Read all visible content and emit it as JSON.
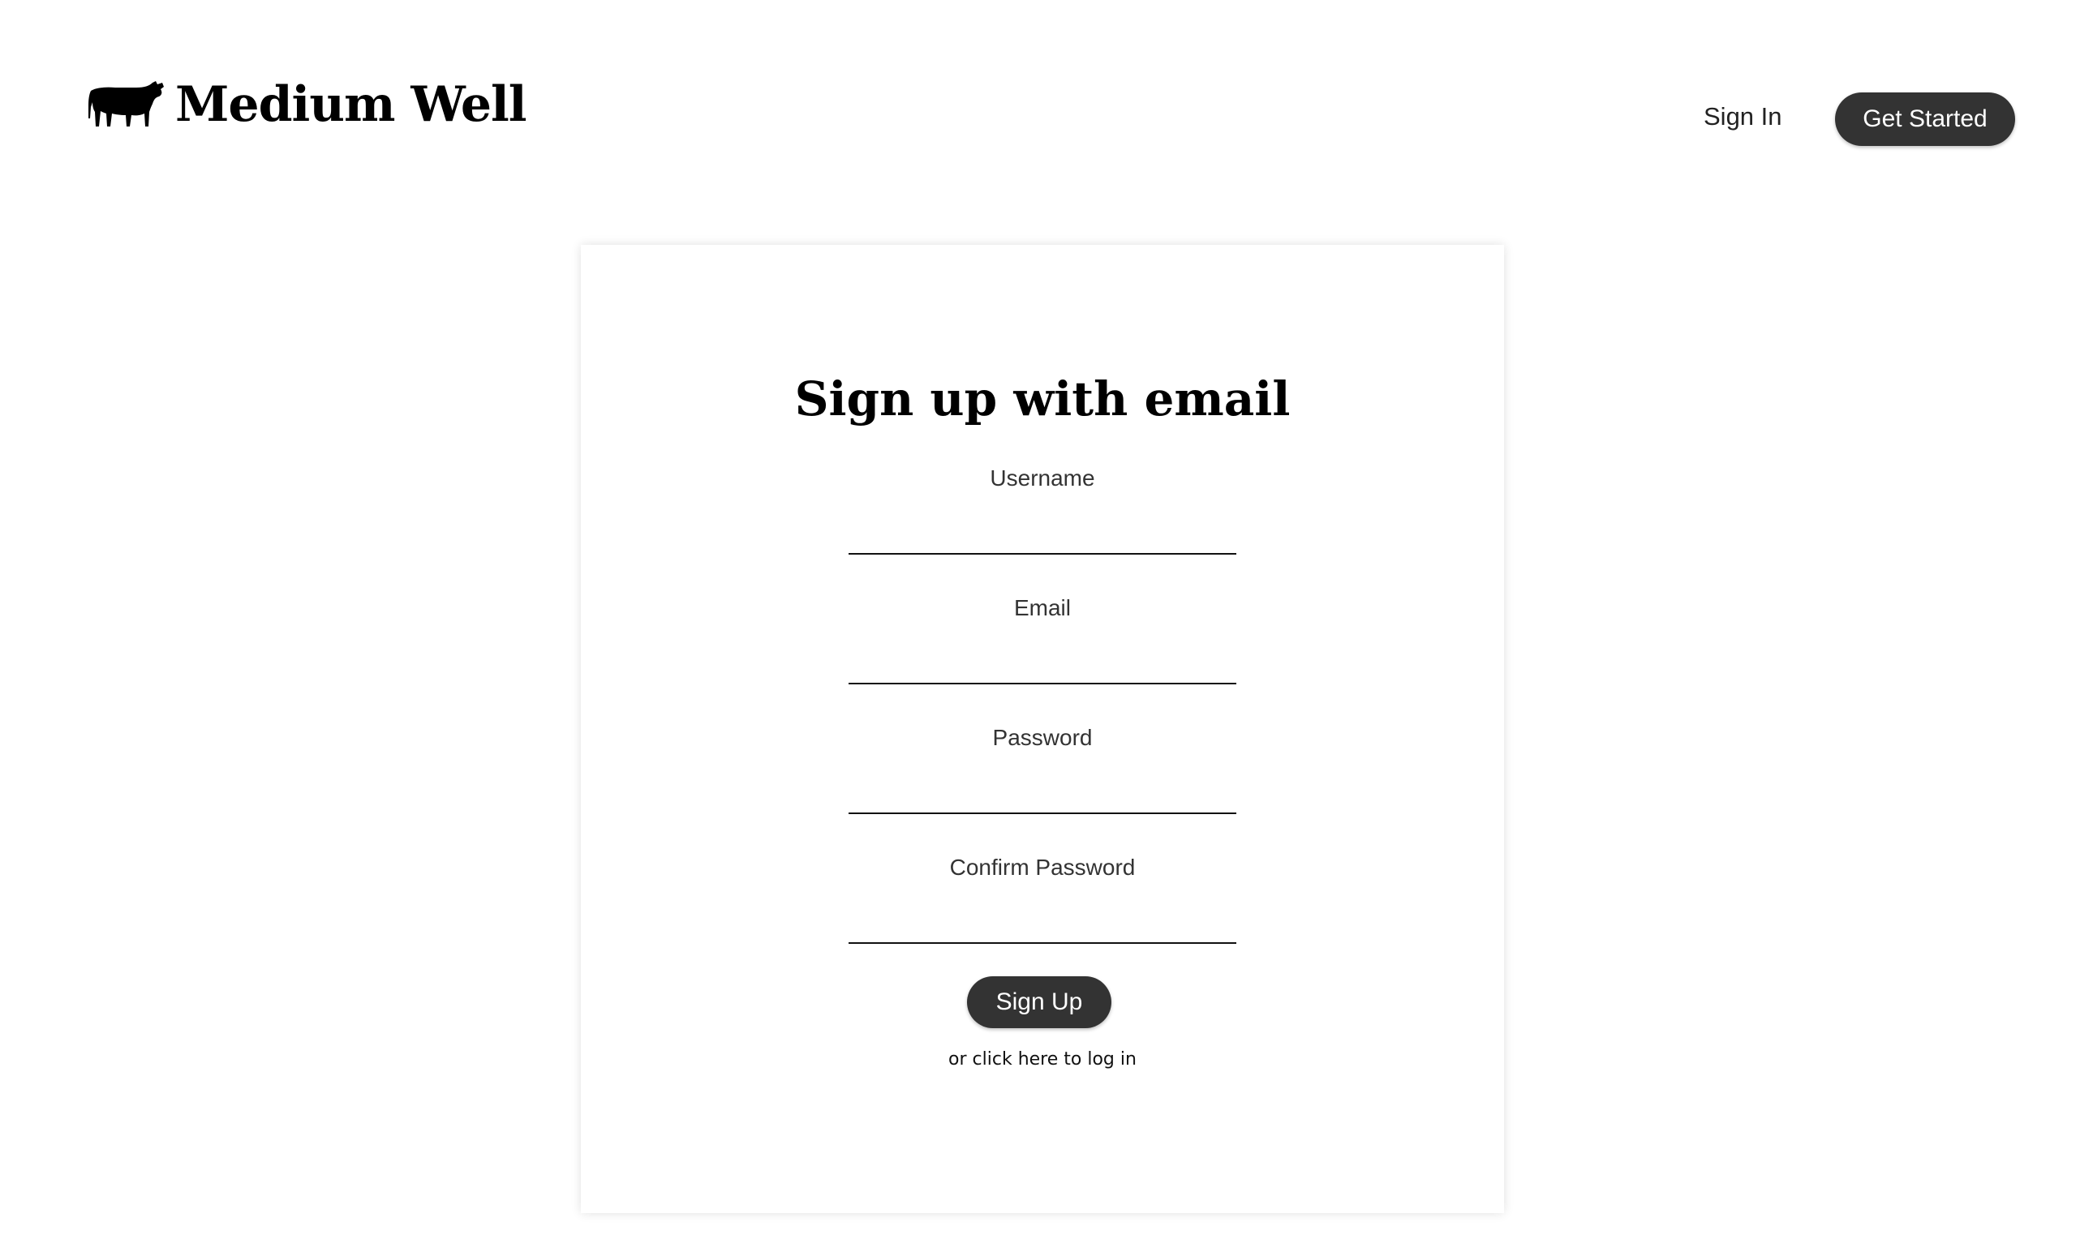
{
  "header": {
    "brand_name": "Medium Well",
    "logo_icon": "cow-icon",
    "sign_in_label": "Sign In",
    "get_started_label": "Get Started"
  },
  "form": {
    "title": "Sign up with email",
    "fields": [
      {
        "label": "Username",
        "value": "",
        "placeholder": ""
      },
      {
        "label": "Email",
        "value": "",
        "placeholder": ""
      },
      {
        "label": "Password",
        "value": "",
        "placeholder": ""
      },
      {
        "label": "Confirm Password",
        "value": "",
        "placeholder": ""
      }
    ],
    "submit_label": "Sign Up",
    "login_link_text": "or click here to log in"
  },
  "colors": {
    "button_bg": "#333333",
    "button_text": "#ffffff",
    "background": "#ffffff"
  }
}
